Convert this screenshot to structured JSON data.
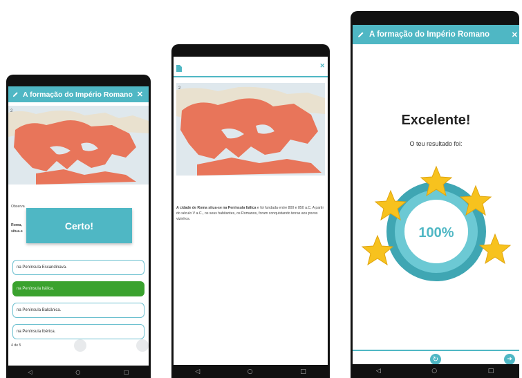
{
  "quiz_title": "A formação do Império Romano",
  "colors": {
    "accent": "#4fb7c4",
    "correct": "#3aa22e",
    "map_empire": "#e8755a",
    "star": "#f7c21e"
  },
  "phone1": {
    "map_number": "2",
    "question_start": "Observa",
    "question_bold": "Roma,",
    "question_bold2": "situa-s",
    "feedback": "Certo!",
    "options": [
      {
        "label": "na Península Escandinava.",
        "state": "normal"
      },
      {
        "label": "na Península Itálica.",
        "state": "correct"
      },
      {
        "label": "na Península Balcânica.",
        "state": "normal"
      },
      {
        "label": "na Península Ibérica.",
        "state": "normal"
      }
    ],
    "progress": "4 de 5"
  },
  "phone2": {
    "map_number": "2",
    "text_bold": "A cidade de Roma situa-se na Península Itálica",
    "text_rest": " e foi fundada entre 800 e 850 a.C. A partir do século V a.C., os seus habitantes, os Romanos, foram conquistando terras aos povos vizinhos."
  },
  "phone3": {
    "heading": "Excelente!",
    "subheading": "O teu resultado foi:",
    "score": "100%",
    "score_value": 100,
    "stars": 5
  },
  "nav_icons": [
    "back-icon",
    "home-icon",
    "recents-icon"
  ]
}
